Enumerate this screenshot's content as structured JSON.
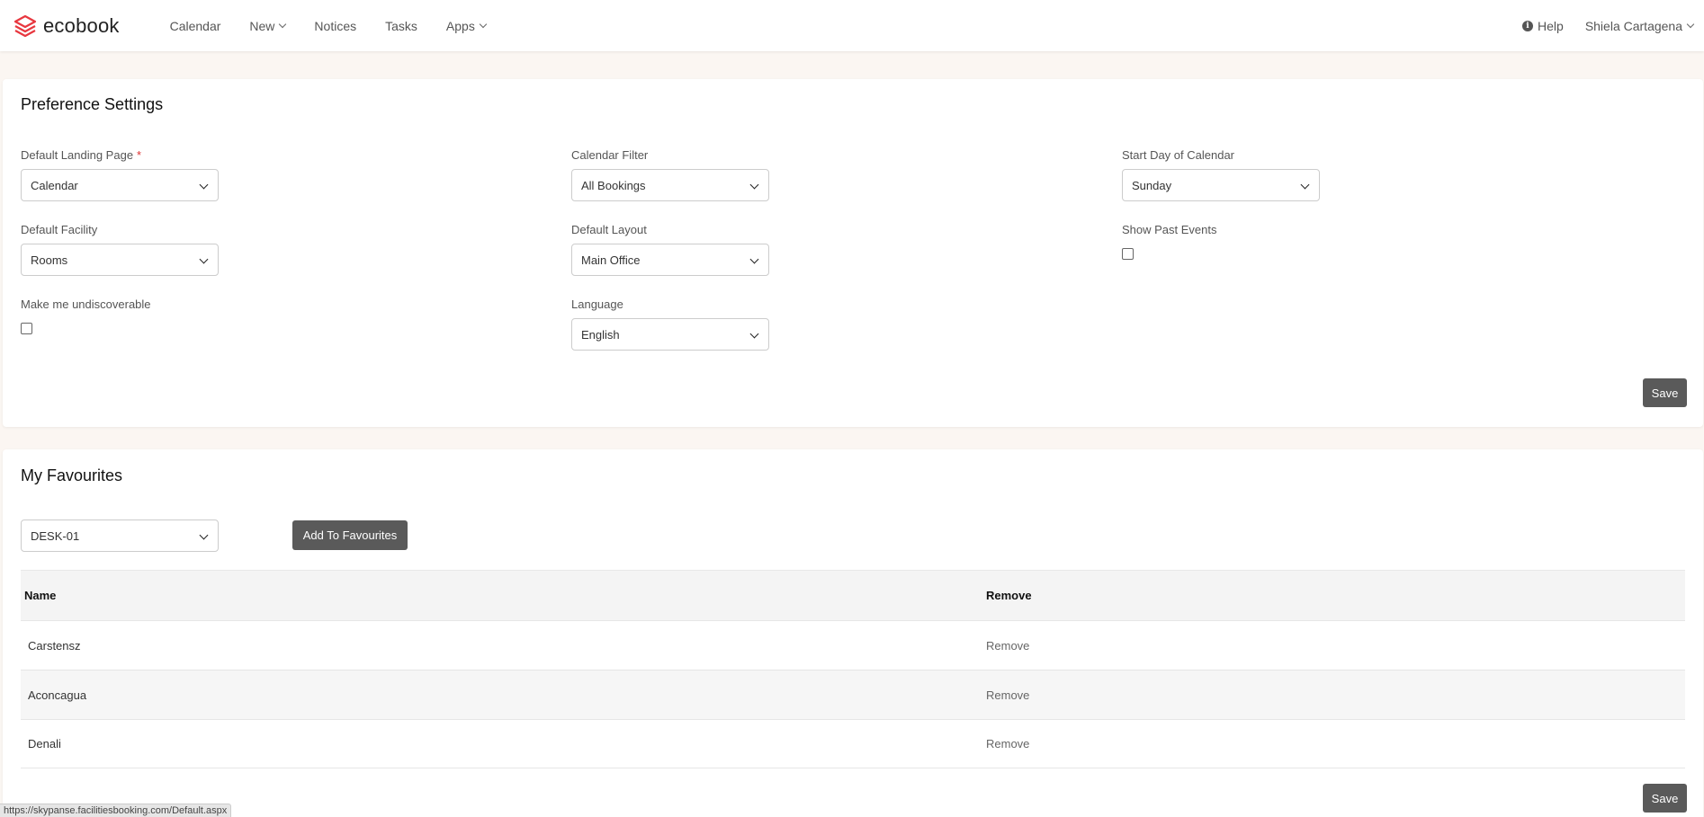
{
  "app": {
    "name": "ecobook",
    "brand_color": "#e8373f"
  },
  "nav": {
    "items": [
      {
        "label": "Calendar",
        "dropdown": false
      },
      {
        "label": "New",
        "dropdown": true
      },
      {
        "label": "Notices",
        "dropdown": false
      },
      {
        "label": "Tasks",
        "dropdown": false
      },
      {
        "label": "Apps",
        "dropdown": true
      }
    ],
    "help_label": "Help",
    "user_name": "Shiela Cartagena"
  },
  "preferences": {
    "title": "Preference Settings",
    "default_landing_page": {
      "label": "Default Landing Page",
      "value": "Calendar"
    },
    "calendar_filter": {
      "label": "Calendar Filter",
      "value": "All Bookings"
    },
    "start_day": {
      "label": "Start Day of Calendar",
      "value": "Sunday"
    },
    "default_facility": {
      "label": "Default Facility",
      "value": "Rooms"
    },
    "default_layout": {
      "label": "Default Layout",
      "value": "Main Office"
    },
    "show_past_events": {
      "label": "Show Past Events",
      "checked": false
    },
    "undiscoverable": {
      "label": "Make me undiscoverable",
      "checked": false
    },
    "language": {
      "label": "Language",
      "value": "English"
    },
    "save_label": "Save"
  },
  "favourites": {
    "title": "My Favourites",
    "select_value": "DESK-01",
    "add_label": "Add To Favourites",
    "columns": {
      "name": "Name",
      "remove": "Remove"
    },
    "rows": [
      {
        "name": "Carstensz",
        "action": "Remove"
      },
      {
        "name": "Aconcagua",
        "action": "Remove"
      },
      {
        "name": "Denali",
        "action": "Remove"
      }
    ],
    "save_label": "Save"
  },
  "status_url": "https://skypanse.facilitiesbooking.com/Default.aspx"
}
